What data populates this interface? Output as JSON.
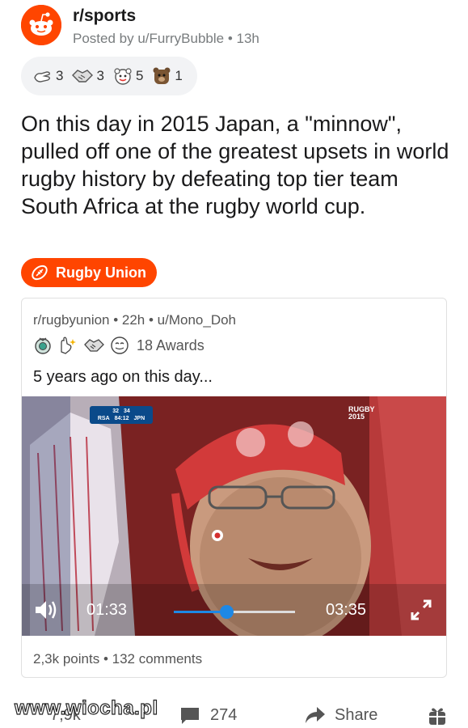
{
  "header": {
    "subreddit": "r/sports",
    "posted_by": "Posted by u/FurryBubble • 13h",
    "avatar_icon": "reddit-alien-icon"
  },
  "awards": [
    {
      "icon": "hand-heart-icon",
      "count": "3"
    },
    {
      "icon": "handshake-icon",
      "count": "3"
    },
    {
      "icon": "wholesome-icon",
      "count": "5"
    },
    {
      "icon": "bear-icon",
      "count": "1"
    }
  ],
  "post": {
    "title": "On this day in 2015 Japan, a \"minnow\", pulled off one of the greatest upsets in world rugby history by defeating top tier team South Africa at the rugby world cup.",
    "flair": "Rugby Union",
    "flair_color": "#ff4500"
  },
  "crosspost": {
    "meta": "r/rugbyunion • 22h • u/Mono_Doh",
    "awards_count": "18 Awards",
    "title": "5 years ago on this day...",
    "stats": "2,3k points • 132 comments"
  },
  "video": {
    "current_time": "01:33",
    "total_time": "03:35",
    "progress": 0.433,
    "scorebug": {
      "home": "RSA",
      "home_score": "32",
      "away": "JPN",
      "away_score": "34",
      "clock": "84:12"
    },
    "logo_line1": "RUGBY",
    "logo_line2": "2015",
    "accent_color": "#1e88e5"
  },
  "footer": {
    "score": "7,9k",
    "comments": "274",
    "share": "Share"
  },
  "watermark": "www.wiocha.pl"
}
